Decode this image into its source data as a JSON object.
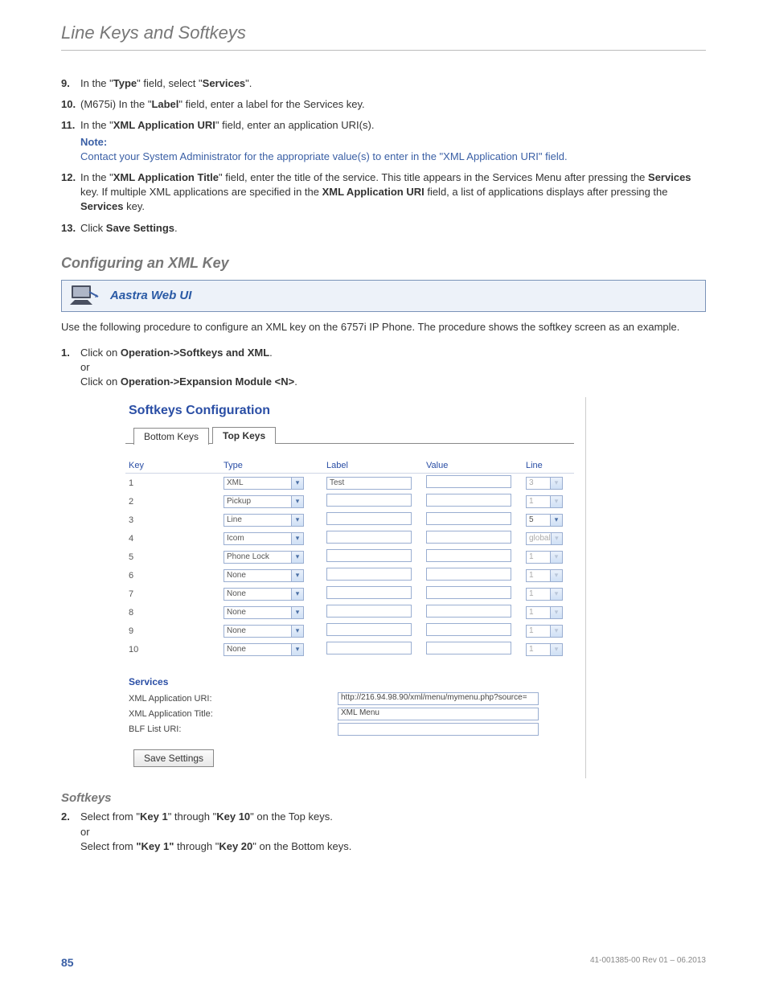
{
  "header": "Line Keys and Softkeys",
  "steps_top": [
    {
      "n": "9.",
      "segments": [
        {
          "t": "In the \""
        },
        {
          "t": "Type",
          "b": true
        },
        {
          "t": "\" field, select \""
        },
        {
          "t": "Services",
          "b": true
        },
        {
          "t": "\"."
        }
      ]
    },
    {
      "n": "10.",
      "segments": [
        {
          "t": "(M675i) In the \""
        },
        {
          "t": "Label",
          "b": true
        },
        {
          "t": "\" field, enter a label for the Services key."
        }
      ]
    },
    {
      "n": "11.",
      "segments": [
        {
          "t": "In the \""
        },
        {
          "t": "XML Application URI",
          "b": true
        },
        {
          "t": "\" field, enter an application URI(s)."
        }
      ],
      "note_label": "Note:",
      "note_text": "Contact your System Administrator for the appropriate value(s) to enter in the \"XML Application URI\" field."
    },
    {
      "n": "12.",
      "segments": [
        {
          "t": "In the \""
        },
        {
          "t": "XML Application Title",
          "b": true
        },
        {
          "t": "\" field, enter the title of the service. This title appears in the Services Menu after pressing the "
        },
        {
          "t": "Services",
          "b": true
        },
        {
          "t": " key. If multiple XML applications are specified in the "
        },
        {
          "t": "XML Application URI",
          "b": true
        },
        {
          "t": " field, a list of applications displays after pressing the "
        },
        {
          "t": "Services",
          "b": true
        },
        {
          "t": " key."
        }
      ]
    },
    {
      "n": "13.",
      "segments": [
        {
          "t": "Click "
        },
        {
          "t": "Save Settings",
          "b": true
        },
        {
          "t": "."
        }
      ]
    }
  ],
  "section1_heading": "Configuring an XML Key",
  "webui_label": "Aastra Web UI",
  "para1": "Use the following procedure to configure an XML key on the 6757i IP Phone. The procedure shows the softkey screen as an example.",
  "step1": {
    "n": "1.",
    "l1a": "Click on ",
    "l1b": "Operation->Softkeys and XML",
    "l1c": ".",
    "or": "or",
    "l2a": "Click on ",
    "l2b": "Operation->Expansion Module <N>",
    "l2c": "."
  },
  "cfg": {
    "title": "Softkeys Configuration",
    "tab_bottom": "Bottom Keys",
    "tab_top": "Top Keys",
    "cols": {
      "key": "Key",
      "type": "Type",
      "label": "Label",
      "value": "Value",
      "line": "Line"
    },
    "rows": [
      {
        "key": "1",
        "type": "XML",
        "label": "Test",
        "value": "",
        "line": "3",
        "line_disabled": true
      },
      {
        "key": "2",
        "type": "Pickup",
        "label": "",
        "value": "",
        "line": "1",
        "line_disabled": true
      },
      {
        "key": "3",
        "type": "Line",
        "label": "",
        "value": "",
        "line": "5",
        "line_disabled": false
      },
      {
        "key": "4",
        "type": "Icom",
        "label": "",
        "value": "",
        "line": "global",
        "line_disabled": true
      },
      {
        "key": "5",
        "type": "Phone Lock",
        "label": "",
        "value": "",
        "line": "1",
        "line_disabled": true
      }
    ],
    "rows2": [
      {
        "key": "6",
        "type": "None",
        "label": "",
        "value": "",
        "line": "1",
        "line_disabled": true
      },
      {
        "key": "7",
        "type": "None",
        "label": "",
        "value": "",
        "line": "1",
        "line_disabled": true
      },
      {
        "key": "8",
        "type": "None",
        "label": "",
        "value": "",
        "line": "1",
        "line_disabled": true
      },
      {
        "key": "9",
        "type": "None",
        "label": "",
        "value": "",
        "line": "1",
        "line_disabled": true
      },
      {
        "key": "10",
        "type": "None",
        "label": "",
        "value": "",
        "line": "1",
        "line_disabled": true
      }
    ],
    "services_heading": "Services",
    "svc1": {
      "label": "XML Application URI:",
      "value": "http://216.94.98.90/xml/menu/mymenu.php?source="
    },
    "svc2": {
      "label": "XML Application Title:",
      "value": "XML Menu"
    },
    "svc3": {
      "label": "BLF List URI:",
      "value": ""
    },
    "save_btn": "Save Settings"
  },
  "section2_heading": "Softkeys",
  "step2": {
    "n": "2.",
    "l1a": "Select from \"",
    "l1b": "Key 1",
    "l1c": "\" through \"",
    "l1d": "Key 10",
    "l1e": "\" on the Top keys.",
    "or": "or",
    "l2a": "Select from ",
    "l2b": "\"Key 1\"",
    "l2c": " through \"",
    "l2d": "Key 20",
    "l2e": "\" on the Bottom keys."
  },
  "footer": {
    "page": "85",
    "rev": "41-001385-00 Rev 01 – 06.2013"
  }
}
